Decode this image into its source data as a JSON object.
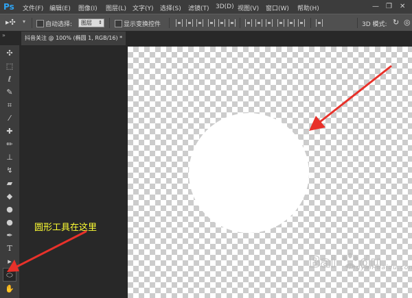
{
  "app": {
    "logo": "Ps"
  },
  "menu": [
    "文件(F)",
    "编辑(E)",
    "图像(I)",
    "图层(L)",
    "文字(Y)",
    "选择(S)",
    "滤镜(T)",
    "3D(D)",
    "视图(V)",
    "窗口(W)",
    "帮助(H)"
  ],
  "options": {
    "auto_select_label": "自动选择:",
    "layer_select_value": "图层",
    "show_transform_label": "显示变换控件",
    "mode_3d_label": "3D 模式:"
  },
  "document": {
    "tab_title": "抖音关注 @ 100% (椭圆 1, RGB/16) *"
  },
  "tools": [
    "move-tool",
    "marquee-tool",
    "lasso-tool",
    "quick-select-tool",
    "crop-tool",
    "eyedropper-tool",
    "healing-tool",
    "brush-tool",
    "stamp-tool",
    "history-brush-tool",
    "eraser-tool",
    "bucket-tool",
    "blur-tool",
    "dodge-tool",
    "pen-tool",
    "type-tool",
    "path-select-tool",
    "ellipse-tool",
    "hand-tool"
  ],
  "annotation": {
    "text": "圆形工具在这里",
    "color": "#ffff33"
  },
  "arrow_color": "#e8312a",
  "watermark": {
    "sub": "jingyan.baidu.com"
  }
}
